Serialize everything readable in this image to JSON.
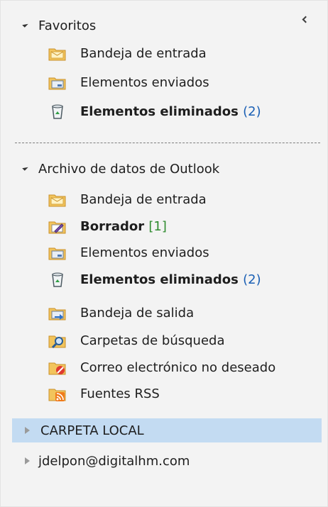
{
  "favorites": {
    "header": "Favoritos",
    "items": [
      {
        "label": "Bandeja de entrada",
        "icon": "inbox-icon"
      },
      {
        "label": "Elementos enviados",
        "icon": "sent-items-icon"
      },
      {
        "label": "Elementos eliminados",
        "count": "(2)",
        "icon": "deleted-items-icon"
      }
    ]
  },
  "datafile": {
    "header": "Archivo de datos de Outlook",
    "items": [
      {
        "label": "Bandeja de entrada",
        "icon": "inbox-icon"
      },
      {
        "label": "Borrador",
        "count": "[1]",
        "icon": "drafts-icon"
      },
      {
        "label": "Elementos enviados",
        "icon": "sent-items-icon"
      },
      {
        "label": "Elementos eliminados",
        "count": "(2)",
        "icon": "deleted-items-icon"
      },
      {
        "label": "Bandeja de salida",
        "icon": "outbox-icon"
      },
      {
        "label": "Carpetas de búsqueda",
        "icon": "search-folder-icon"
      },
      {
        "label": "Correo electrónico no deseado",
        "icon": "junk-mail-icon"
      },
      {
        "label": "Fuentes RSS",
        "icon": "rss-feeds-icon"
      }
    ]
  },
  "local_folder": {
    "label": "CARPETA LOCAL"
  },
  "account": {
    "label": "jdelpon@digitalhm.com"
  },
  "colors": {
    "pane_bg": "#f3f3f3",
    "selection": "#c3dbf2",
    "count_blue": "#1a5fb4",
    "count_green": "#2e8b2e"
  }
}
